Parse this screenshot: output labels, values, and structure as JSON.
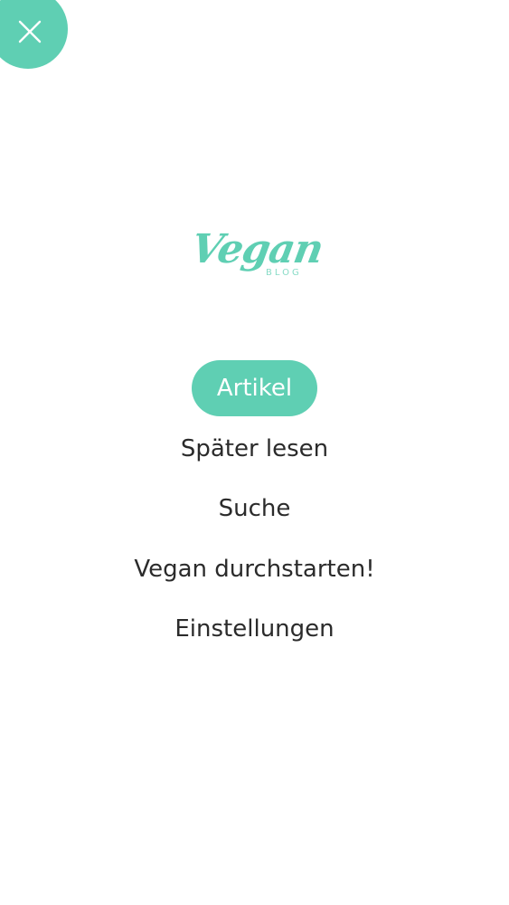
{
  "colors": {
    "accent": "#5fcfb3",
    "text": "#2b2b2b",
    "background": "#ffffff"
  },
  "header": {
    "close_icon": "close-icon"
  },
  "logo": {
    "script": "Vegan",
    "sub": "BLOG"
  },
  "menu": {
    "items": [
      {
        "label": "Artikel",
        "active": true
      },
      {
        "label": "Später lesen",
        "active": false
      },
      {
        "label": "Suche",
        "active": false
      },
      {
        "label": "Vegan durchstarten!",
        "active": false
      },
      {
        "label": "Einstellungen",
        "active": false
      }
    ]
  }
}
